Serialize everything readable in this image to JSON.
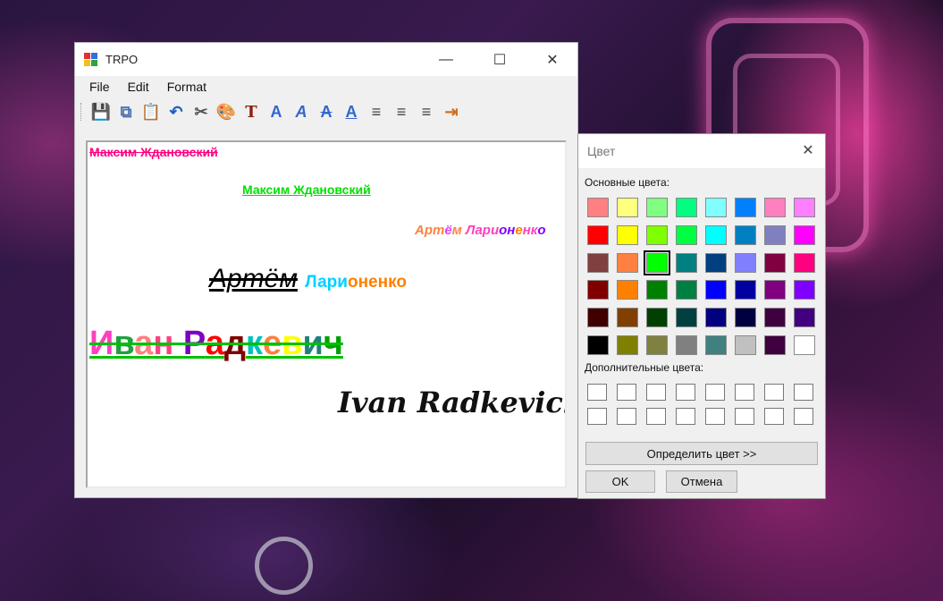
{
  "window": {
    "title": "TRPO",
    "caption": {
      "minimize": "—",
      "maximize": "☐",
      "close": "✕"
    }
  },
  "menu": [
    "File",
    "Edit",
    "Format"
  ],
  "toolbar": [
    {
      "icon": "save-icon",
      "glyph": "💾",
      "color": "#2b4fa0"
    },
    {
      "icon": "copy-icon",
      "glyph": "⧉",
      "color": "#4a6fb0"
    },
    {
      "icon": "paste-icon",
      "glyph": "📋",
      "color": "#7a5a2a"
    },
    {
      "icon": "undo-icon",
      "glyph": "↶",
      "color": "#2060c0"
    },
    {
      "icon": "cut-icon",
      "glyph": "✂",
      "color": "#555"
    },
    {
      "icon": "palette-icon",
      "glyph": "🎨",
      "color": "#c07030"
    },
    {
      "icon": "font-icon",
      "glyph": "T",
      "color": "#8b2010"
    },
    {
      "icon": "bold-icon",
      "glyph": "A",
      "color": "#3366cc"
    },
    {
      "icon": "italic-icon",
      "glyph": "A",
      "color": "#3366cc"
    },
    {
      "icon": "strikethrough-icon",
      "glyph": "A",
      "color": "#3366cc"
    },
    {
      "icon": "underline-icon",
      "glyph": "A",
      "color": "#3366cc"
    },
    {
      "icon": "align-left-icon",
      "glyph": "≡",
      "color": "#444"
    },
    {
      "icon": "align-center-icon",
      "glyph": "≡",
      "color": "#444"
    },
    {
      "icon": "align-right-icon",
      "glyph": "≡",
      "color": "#444"
    },
    {
      "icon": "exit-icon",
      "glyph": "⇥",
      "color": "#d07020"
    }
  ],
  "editor": {
    "line1": "Максим Ждановский",
    "line2": "Максим Ждановский",
    "line3": [
      {
        "t": "Арт",
        "c": "#ff8040"
      },
      {
        "t": "ё",
        "c": "#e040ff"
      },
      {
        "t": "м ",
        "c": "#ff8040"
      },
      {
        "t": "Лари",
        "c": "#ff40c0"
      },
      {
        "t": "он",
        "c": "#8000ff"
      },
      {
        "t": "е",
        "c": "#ff8000"
      },
      {
        "t": "нк",
        "c": "#ff40c0"
      },
      {
        "t": "о",
        "c": "#8000ff"
      }
    ],
    "line4a": "Артём",
    "line4b": [
      {
        "t": "Лари",
        "c": "#00d0ff"
      },
      {
        "t": "о",
        "c": "#ff8000"
      },
      {
        "t": "нен",
        "c": "#ff8000"
      },
      {
        "t": "ко",
        "c": "#ff8000"
      }
    ],
    "line5": [
      {
        "t": "И",
        "c": "#ff40c0"
      },
      {
        "t": "в",
        "c": "#20a040"
      },
      {
        "t": "а",
        "c": "#ff8080"
      },
      {
        "t": "н ",
        "c": "#ff4080"
      },
      {
        "t": "Р",
        "c": "#8000c0"
      },
      {
        "t": "а",
        "c": "#ff0000"
      },
      {
        "t": "д",
        "c": "#800000"
      },
      {
        "t": "к",
        "c": "#00c0c0"
      },
      {
        "t": "е",
        "c": "#ff8040"
      },
      {
        "t": "в",
        "c": "#ffff00"
      },
      {
        "t": "и",
        "c": "#208080"
      },
      {
        "t": "ч",
        "c": "#00a000"
      }
    ],
    "line6": "Ivan Radkevich"
  },
  "dialog": {
    "title": "Цвет",
    "close": "✕",
    "basic_label": "Основные цвета:",
    "custom_label": "Дополнительные цвета:",
    "define_button": "Определить цвет >>",
    "ok_button": "OK",
    "cancel_button": "Отмена",
    "selected_color": "#00ff00",
    "basic_colors": [
      "#ff8080",
      "#ffff80",
      "#80ff80",
      "#00ff80",
      "#80ffff",
      "#0080ff",
      "#ff80c0",
      "#ff80ff",
      "#ff0000",
      "#ffff00",
      "#80ff00",
      "#00ff40",
      "#00ffff",
      "#0080c0",
      "#8080c0",
      "#ff00ff",
      "#804040",
      "#ff8040",
      "#00ff00",
      "#008080",
      "#004080",
      "#8080ff",
      "#800040",
      "#ff0080",
      "#800000",
      "#ff8000",
      "#008000",
      "#008040",
      "#0000ff",
      "#0000a0",
      "#800080",
      "#8000ff",
      "#400000",
      "#804000",
      "#004000",
      "#004040",
      "#000080",
      "#000040",
      "#400040",
      "#400080",
      "#000000",
      "#808000",
      "#808040",
      "#808080",
      "#408080",
      "#c0c0c0",
      "#400040",
      "#ffffff"
    ],
    "custom_colors": [
      "#ffffff",
      "#ffffff",
      "#ffffff",
      "#ffffff",
      "#ffffff",
      "#ffffff",
      "#ffffff",
      "#ffffff",
      "#ffffff",
      "#ffffff",
      "#ffffff",
      "#ffffff",
      "#ffffff",
      "#ffffff",
      "#ffffff",
      "#ffffff"
    ]
  }
}
